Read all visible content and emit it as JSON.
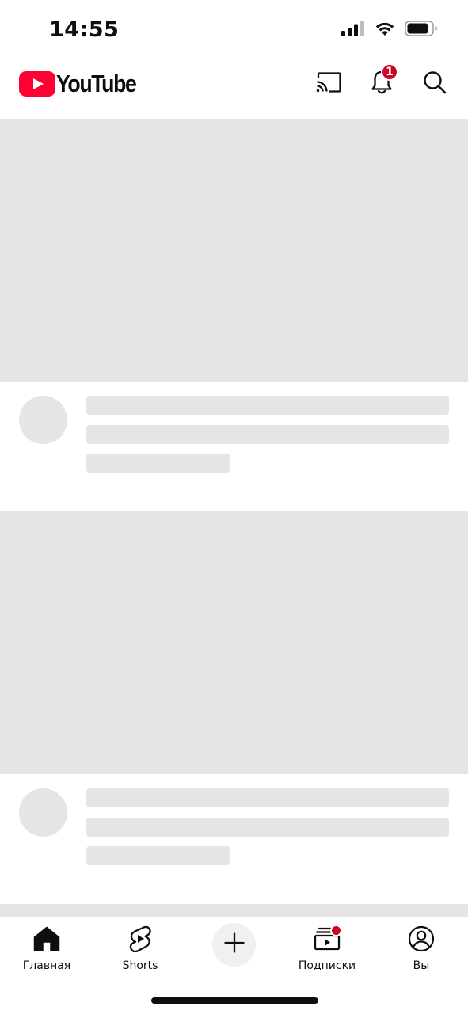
{
  "status_bar": {
    "time": "14:55",
    "icons": [
      "signal-icon",
      "wifi-icon",
      "battery-icon"
    ]
  },
  "header": {
    "logo_text": "YouTube",
    "brand_color": "#ff0033",
    "actions": [
      "cast-icon",
      "notifications-icon",
      "search-icon"
    ],
    "notification_count": "1",
    "badge_color": "#cc0625"
  },
  "feed": {
    "state": "loading-skeleton",
    "placeholder_color": "#e5e5e5",
    "skeleton_cards": 2
  },
  "bottom_nav": {
    "items": [
      {
        "label": "Главная",
        "icon": "home-icon",
        "selected": true
      },
      {
        "label": "Shorts",
        "icon": "shorts-icon"
      },
      {
        "label": "",
        "icon": "plus-icon"
      },
      {
        "label": "Подписки",
        "icon": "subscriptions-icon",
        "has_new_dot": true
      },
      {
        "label": "Вы",
        "icon": "profile-icon"
      }
    ]
  }
}
